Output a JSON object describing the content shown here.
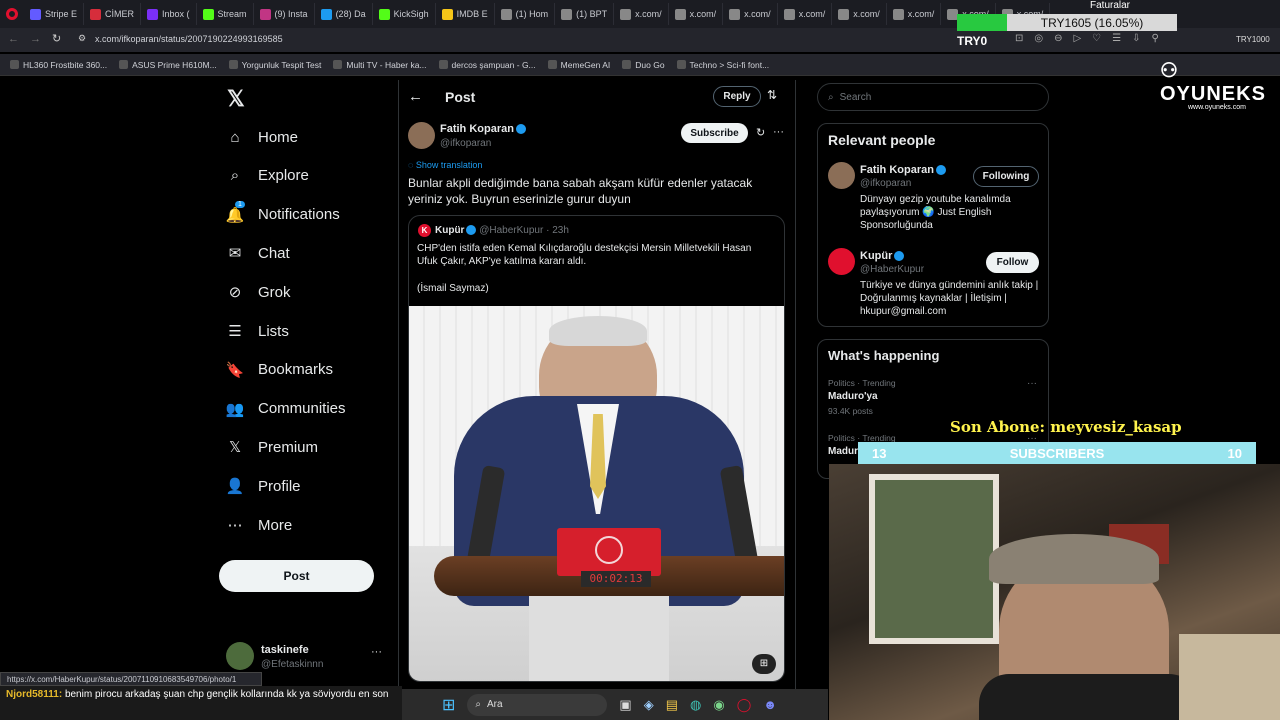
{
  "browser": {
    "tabs": [
      "Stripe E",
      "CİMER",
      "Inbox (",
      "Stream",
      "(9) Insta",
      "(28) Da",
      "KickSigh",
      "IMDB E",
      "(1) Hom",
      "(1) BPT",
      "x.com/",
      "x.com/",
      "x.com/",
      "x.com/",
      "x.com/",
      "x.com/",
      "x.com/",
      "x.com/"
    ],
    "url": "x.com/ifkoparan/status/2007190224993169585",
    "bookmarks": [
      "HL360 Frostbite 360...",
      "ASUS Prime H610M...",
      "Yorgunluk Tespit Test",
      "Multi TV - Haber ka...",
      "dercos şampuan - G...",
      "MemeGen AI",
      "Duo Go",
      "Techno > Sci-fi font..."
    ]
  },
  "overlay": {
    "try_box": "TRY1605 (16.05%)",
    "try_label": "TRY0",
    "try_right": "TRY1000",
    "faturalar": "Faturalar",
    "brand": "OYUNEKS",
    "brand_url": "www.oyuneks.com",
    "son_abone": "Son Abone: meyvesiz_kasap",
    "subs_left": "13",
    "subs_label": "SUBSCRIBERS",
    "subs_right": "10",
    "chat_user": "Njord58111:",
    "chat_text": "benim pirocu arkadaş şuan chp gençlik kollarında kk ya söviyordu en son",
    "status_url": "https://x.com/HaberKupur/status/2007110910683549706/photo/1",
    "taskbar_search": "Ara"
  },
  "nav": {
    "items": [
      "Home",
      "Explore",
      "Notifications",
      "Chat",
      "Grok",
      "Lists",
      "Bookmarks",
      "Communities",
      "Premium",
      "Profile",
      "More"
    ],
    "notif_badge": "1",
    "post_button": "Post",
    "account_name": "taskinefe",
    "account_handle": "@Efetaskinnn"
  },
  "post": {
    "header": "Post",
    "reply_button": "Reply",
    "author_name": "Fatih Koparan",
    "author_handle": "@ifkoparan",
    "subscribe_button": "Subscribe",
    "show_translation": "Show translation",
    "text": "Bunlar akpli dediğimde bana sabah akşam küfür edenler yatacak yeriniz yok. Buyrun eserinizle gurur duyun",
    "quote": {
      "name": "Kupür",
      "handle": "@HaberKupur",
      "time": "23h",
      "text": "CHP'den istifa eden Kemal Kılıçdaroğlu destekçisi Mersin Milletvekili Hasan Ufuk Çakır, AKP'ye katılma kararı aldı.",
      "credit": "(İsmail Saymaz)",
      "image_clock": "00:02:13"
    }
  },
  "right": {
    "search_placeholder": "Search",
    "relevant_title": "Relevant people",
    "people": [
      {
        "name": "Fatih Koparan",
        "handle": "@ifkoparan",
        "button": "Following",
        "bio": "Dünyayı gezip youtube kanalımda paylaşıyorum 🌍 Just English Sponsorluğunda"
      },
      {
        "name": "Kupür",
        "handle": "@HaberKupur",
        "button": "Follow",
        "bio": "Türkiye ve dünya gündemini anlık takip | Doğrulanmış kaynaklar | İletişim | hkupur@gmail.com"
      }
    ],
    "happening_title": "What's happening",
    "trends": [
      {
        "meta": "Politics · Trending",
        "topic": "Maduro'ya",
        "count": "93.4K posts"
      },
      {
        "meta": "Politics · Trending",
        "topic": "Madur",
        "count": ""
      }
    ]
  },
  "colors": {
    "accent": "#1d9bf0",
    "background": "#000000",
    "kupur_red": "#e0102e",
    "subs_bar": "#98e4ee"
  }
}
